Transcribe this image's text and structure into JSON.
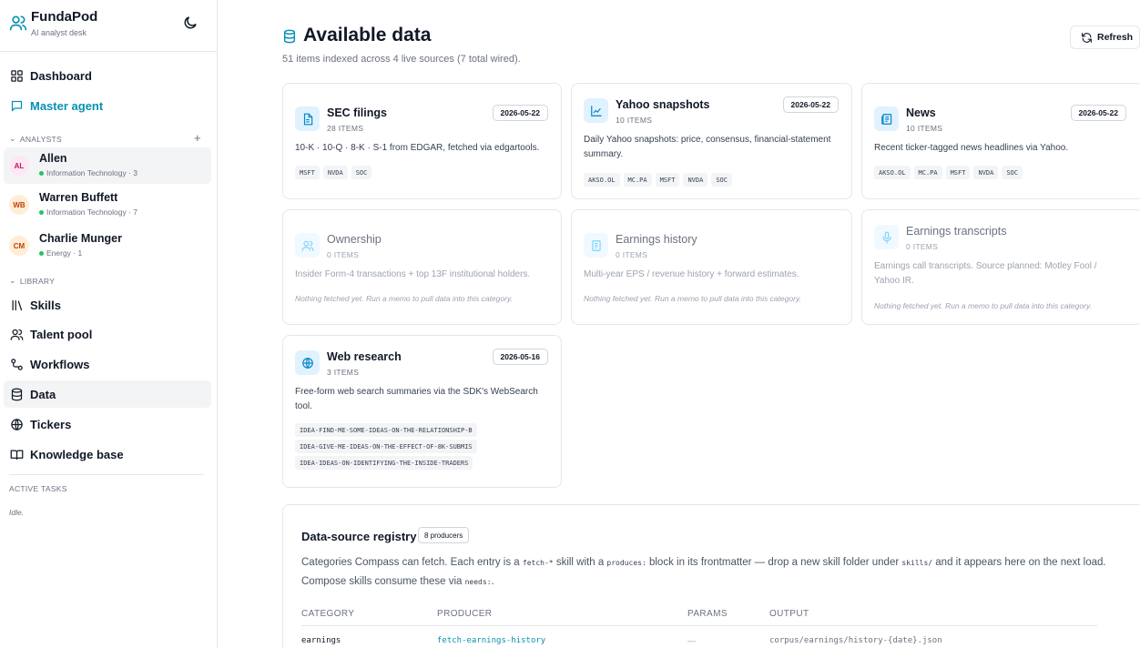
{
  "brand": {
    "name": "FundaPod",
    "subtitle": "AI analyst desk"
  },
  "nav": {
    "dashboard": "Dashboard",
    "master_agent": "Master agent"
  },
  "analysts_section": {
    "label": "ANALYSTS"
  },
  "analysts": [
    {
      "initials": "AL",
      "name": "Allen",
      "meta": "Information Technology · 3",
      "bg": "#fce7f3",
      "fg": "#be185d"
    },
    {
      "initials": "WB",
      "name": "Warren Buffett",
      "meta": "Information Technology · 7",
      "bg": "#ffedd5",
      "fg": "#c2410c"
    },
    {
      "initials": "CM",
      "name": "Charlie Munger",
      "meta": "Energy · 1",
      "bg": "#ffedd5",
      "fg": "#c2410c"
    }
  ],
  "library_section": {
    "label": "LIBRARY"
  },
  "library": {
    "skills": "Skills",
    "talent_pool": "Talent pool",
    "workflows": "Workflows",
    "data": "Data",
    "tickers": "Tickers",
    "knowledge_base": "Knowledge base"
  },
  "active_tasks": {
    "label": "ACTIVE TASKS",
    "status": "Idle."
  },
  "page": {
    "title": "Available data",
    "subtitle": "51 items indexed across 4 live sources (7 total wired).",
    "refresh_label": "Refresh"
  },
  "cards": [
    {
      "title": "SEC filings",
      "count": "28 ITEMS",
      "date": "2026-05-22",
      "desc": "10-K · 10-Q · 8-K · S-1 from EDGAR, fetched via edgartools.",
      "chips": [
        "MSFT",
        "NVDA",
        "SOC"
      ]
    },
    {
      "title": "Yahoo snapshots",
      "count": "10 ITEMS",
      "date": "2026-05-22",
      "desc": "Daily Yahoo snapshots: price, consensus, financial-statement summary.",
      "chips": [
        "AKSO.OL",
        "MC.PA",
        "MSFT",
        "NVDA",
        "SOC"
      ]
    },
    {
      "title": "News",
      "count": "10 ITEMS",
      "date": "2026-05-22",
      "desc": "Recent ticker-tagged news headlines via Yahoo.",
      "chips": [
        "AKSO.OL",
        "MC.PA",
        "MSFT",
        "NVDA",
        "SOC"
      ]
    },
    {
      "title": "Ownership",
      "count": "0 ITEMS",
      "desc": "Insider Form-4 transactions + top 13F institutional holders.",
      "note": "Nothing fetched yet. Run a memo to pull data into this category."
    },
    {
      "title": "Earnings history",
      "count": "0 ITEMS",
      "desc": "Multi-year EPS / revenue history + forward estimates.",
      "note": "Nothing fetched yet. Run a memo to pull data into this category."
    },
    {
      "title": "Earnings transcripts",
      "count": "0 ITEMS",
      "desc": "Earnings call transcripts. Source planned: Motley Fool / Yahoo IR.",
      "note": "Nothing fetched yet. Run a memo to pull data into this category."
    },
    {
      "title": "Web research",
      "count": "3 ITEMS",
      "date": "2026-05-16",
      "desc": "Free-form web search summaries via the SDK's WebSearch tool.",
      "chips": [
        "IDEA-FIND-ME-SOME-IDEAS-ON-THE-RELATIONSHIP-B",
        "IDEA-GIVE-ME-IDEAS-ON-THE-EFFECT-OF-8K-SUBMIS",
        "IDEA-IDEAS-ON-IDENTIFYING-THE-INSIDE-TRADERS"
      ]
    }
  ],
  "registry": {
    "title": "Data-source registry",
    "badge": "8 producers",
    "desc_1": "Categories Compass can fetch. Each entry is a ",
    "code_1": "fetch-*",
    "desc_2": " skill with a ",
    "code_2": "produces:",
    "desc_3": " block in its frontmatter — drop a new skill folder under ",
    "code_3": "skills/",
    "desc_4": " and it appears here on the next load. Compose skills consume these via ",
    "code_4": "needs:",
    "desc_5": ".",
    "headers": {
      "category": "CATEGORY",
      "producer": "PRODUCER",
      "params": "PARAMS",
      "output": "OUTPUT"
    },
    "rows": [
      {
        "category": "earnings",
        "producer": "fetch-earnings-history",
        "params": "—",
        "output": "corpus/earnings/history-{date}.json"
      }
    ]
  },
  "colors": {
    "accent": "#0891b2",
    "status_green": "#22c55e",
    "icon_tile": "#e0f2fe"
  }
}
